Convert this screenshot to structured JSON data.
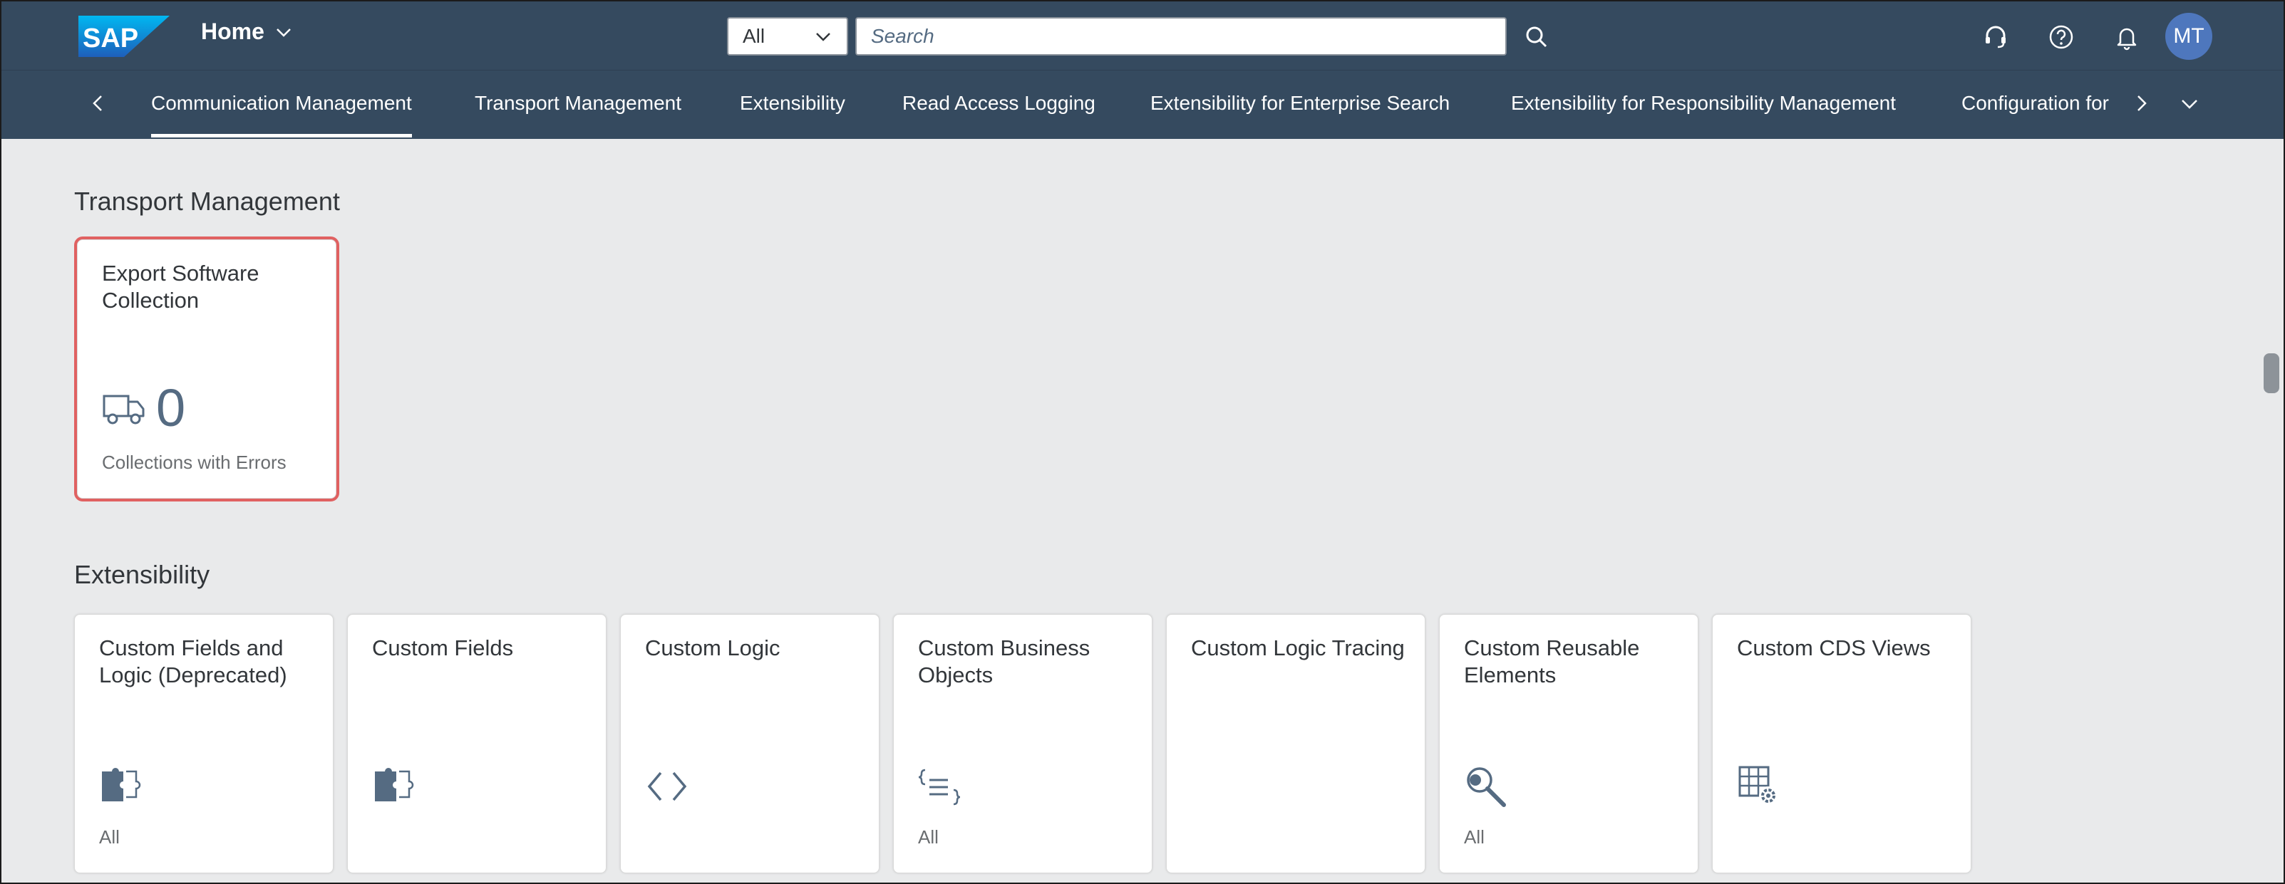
{
  "shell": {
    "logo_text": "SAP",
    "home_label": "Home",
    "search_scope": "All",
    "search_placeholder": "Search",
    "user_initials": "MT"
  },
  "tabs": [
    {
      "label": "Communication Management",
      "active": true
    },
    {
      "label": "Transport Management"
    },
    {
      "label": "Extensibility"
    },
    {
      "label": "Read Access Logging"
    },
    {
      "label": "Extensibility for Enterprise Search"
    },
    {
      "label": "Extensibility for Responsibility Management"
    },
    {
      "label": "Configuration for"
    }
  ],
  "sections": {
    "transport": {
      "title": "Transport Management",
      "tiles": [
        {
          "title": "Export Software Collection",
          "value": "0",
          "footer": "Collections with Errors",
          "icon": "truck-icon"
        }
      ]
    },
    "extensibility": {
      "title": "Extensibility",
      "tiles": [
        {
          "title": "Custom Fields and Logic (Deprecated)",
          "footer": "All",
          "icon": "puzzle-icon"
        },
        {
          "title": "Custom Fields",
          "footer": "",
          "icon": "puzzle-icon"
        },
        {
          "title": "Custom Logic",
          "footer": "",
          "icon": "code-icon"
        },
        {
          "title": "Custom Business Objects",
          "footer": "All",
          "icon": "curly-list-icon"
        },
        {
          "title": "Custom Logic Tracing",
          "footer": "",
          "icon": ""
        },
        {
          "title": "Custom Reusable Elements",
          "footer": "All",
          "icon": "magnifier-icon"
        },
        {
          "title": "Custom CDS Views",
          "footer": "",
          "icon": "table-gear-icon"
        }
      ]
    }
  },
  "colors": {
    "shell": "#354a5f",
    "accent": "#4e77bd",
    "selection": "#e06161",
    "icon": "#556b82"
  }
}
